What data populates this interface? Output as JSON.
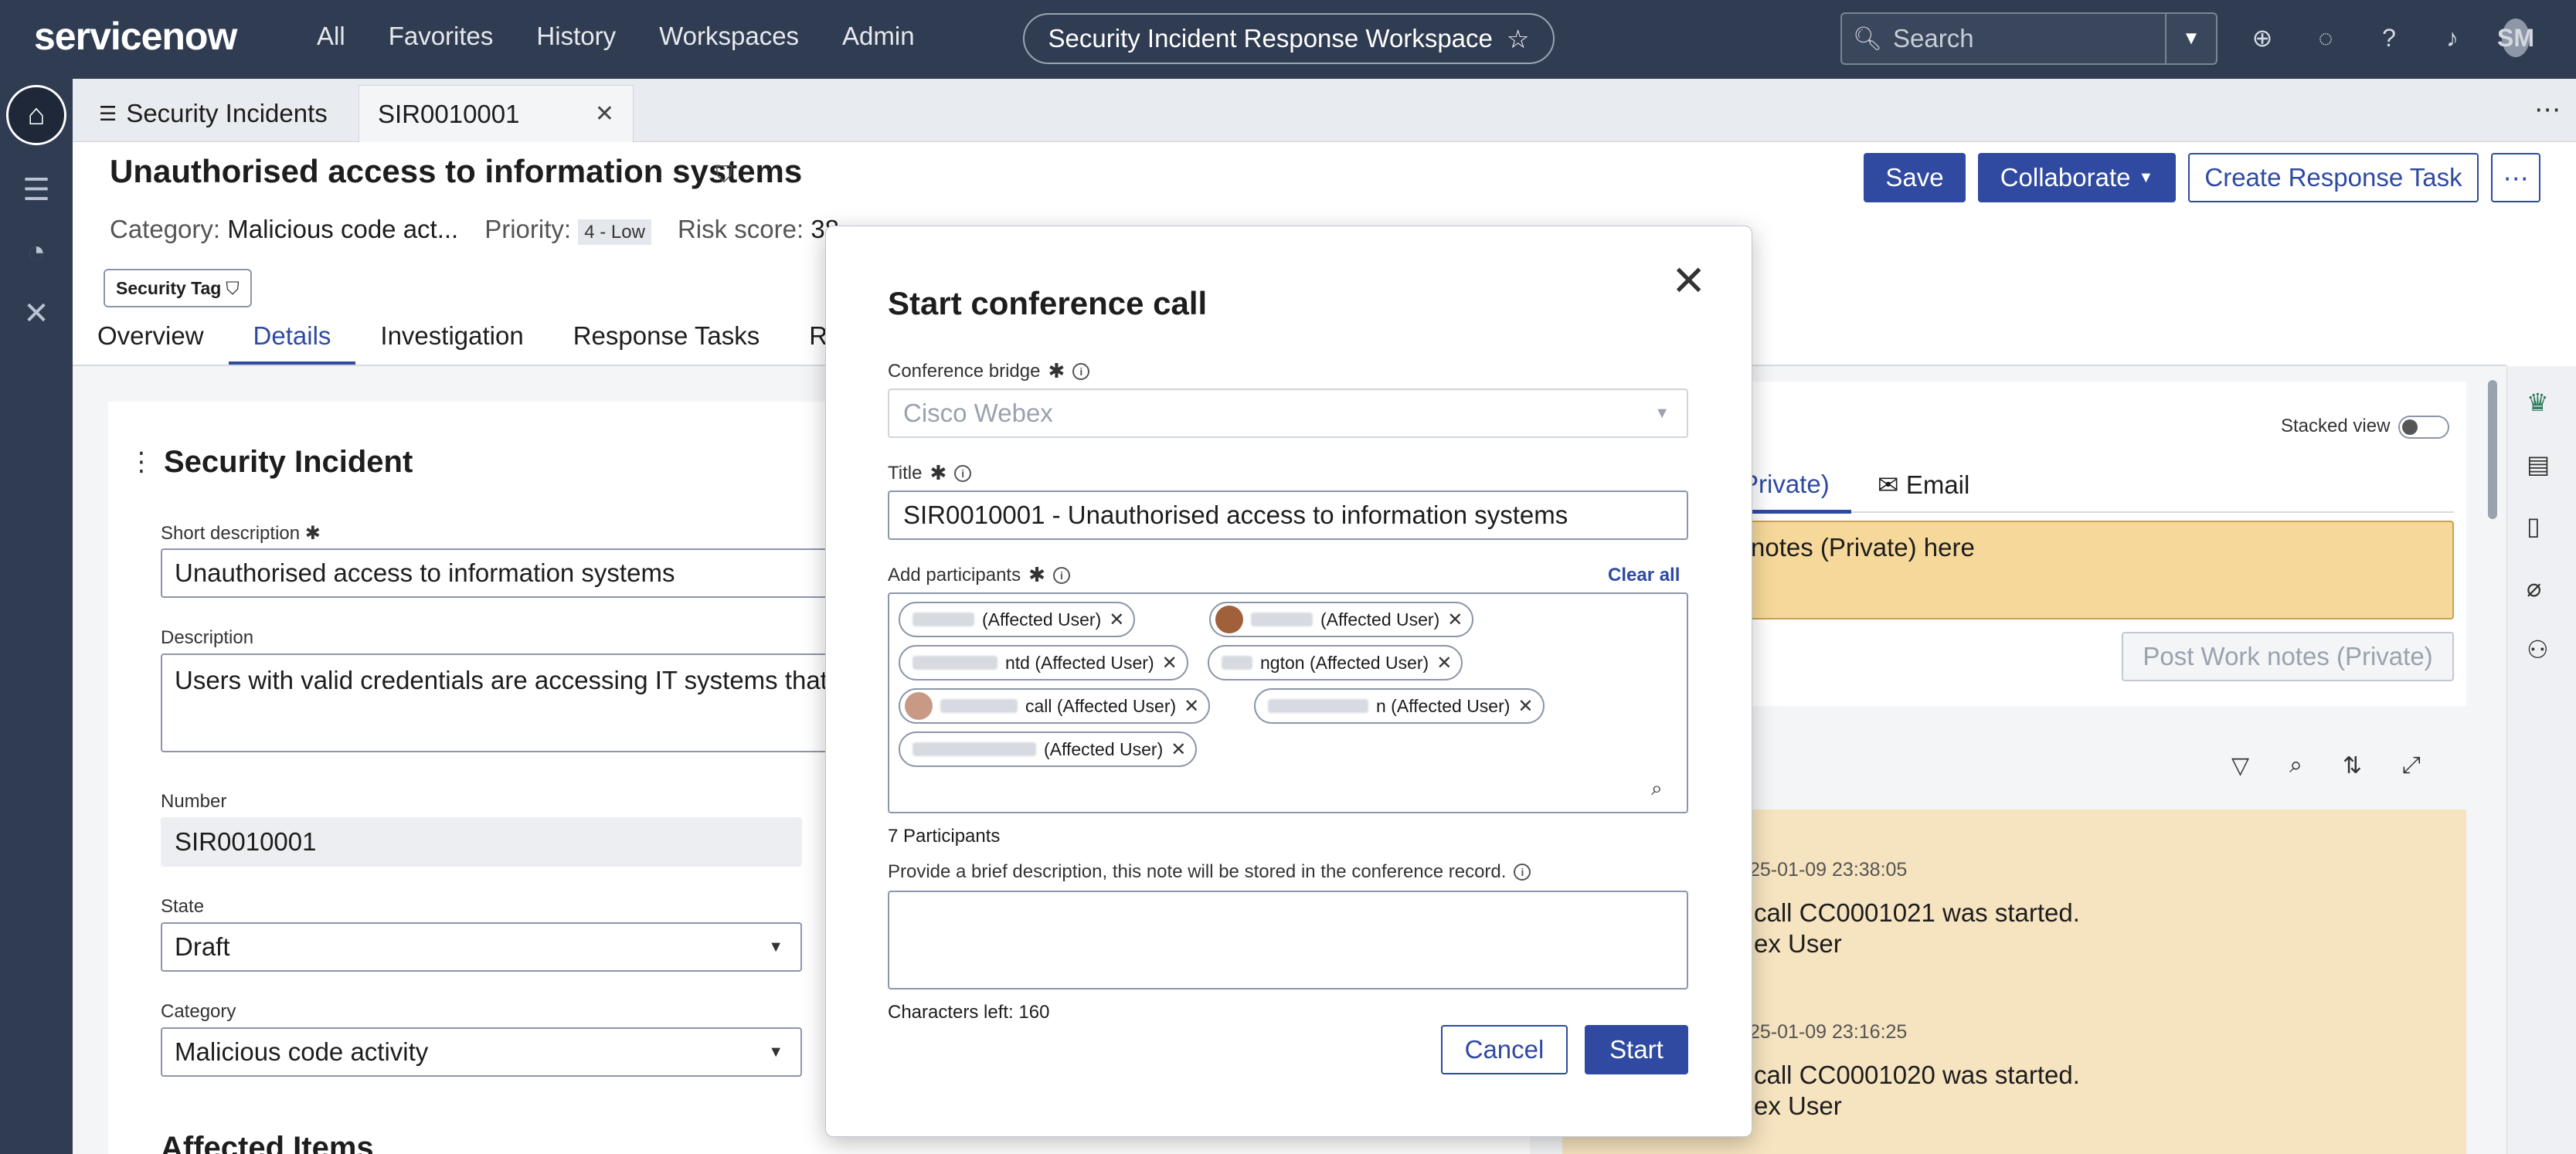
{
  "topbar": {
    "logo": "servicenow",
    "nav": [
      "All",
      "Favorites",
      "History",
      "Workspaces",
      "Admin"
    ],
    "workspace": "Security Incident Response Workspace",
    "search_placeholder": "Search",
    "user_initials": "SM"
  },
  "tabs": {
    "list_tab": "Security Incidents",
    "record_tab": "SIR0010001"
  },
  "record": {
    "title": "Unauthorised access to information systems",
    "actions": {
      "save": "Save",
      "collaborate": "Collaborate",
      "create_task": "Create Response Task",
      "more": "⋯"
    },
    "meta": {
      "category_label": "Category:",
      "category_value": "Malicious code act...",
      "priority_label": "Priority:",
      "priority_value": "4 - Low",
      "risk_label": "Risk score:",
      "risk_value": "38"
    },
    "security_tag": "Security Tag",
    "tabs": [
      "Overview",
      "Details",
      "Investigation",
      "Response Tasks",
      "Rela"
    ]
  },
  "form": {
    "section_title": "Security Incident",
    "short_description_label": "Short description",
    "short_description_value": "Unauthorised access to information systems",
    "description_label": "Description",
    "description_value": "Users with valid credentials are accessing IT systems that sho",
    "number_label": "Number",
    "number_value": "SIR0010001",
    "state_label": "State",
    "state_value": "Draft",
    "category_label": "Category",
    "category_value": "Malicious code activity",
    "affected_items": "Affected Items"
  },
  "activity": {
    "stacked_view": "Stacked view",
    "tab_private": "Private)",
    "tab_email": "Email",
    "notes_placeholder": "notes (Private) here",
    "post_button": "Post Work notes (Private)",
    "entries": [
      {
        "date": "25-01-09 23:38:05",
        "line1": "call CC0001021 was started.",
        "line2": "ex User"
      },
      {
        "date": "25-01-09 23:16:25",
        "line1": "call CC0001020 was started.",
        "line2": "ex User"
      }
    ]
  },
  "modal": {
    "title": "Start conference call",
    "bridge_label": "Conference bridge",
    "bridge_value": "Cisco Webex",
    "title_label": "Title",
    "title_value": "SIR0010001 - Unauthorised access to information systems",
    "participants_label": "Add participants",
    "clear_all": "Clear all",
    "participants": [
      {
        "text": "(Affected User)",
        "avatar": false
      },
      {
        "text": "(Affected User)",
        "avatar": true,
        "avatar_color": "#a0603a"
      },
      {
        "text": "ntd (Affected User)",
        "avatar": false
      },
      {
        "text": "ngton (Affected User)",
        "avatar": false
      },
      {
        "text": "call (Affected User)",
        "avatar": true,
        "avatar_color": "#c89a86"
      },
      {
        "text": "n (Affected User)",
        "avatar": false
      },
      {
        "text": "(Affected User)",
        "avatar": false
      }
    ],
    "participant_count": "7 Participants",
    "desc_label": "Provide a brief description, this note will be stored in the conference record.",
    "chars_left": "Characters left: 160",
    "cancel": "Cancel",
    "start": "Start"
  },
  "colors": {
    "brand": "#2f4aa0",
    "topbar": "#303c52",
    "notes_bg": "#f6d99a"
  }
}
